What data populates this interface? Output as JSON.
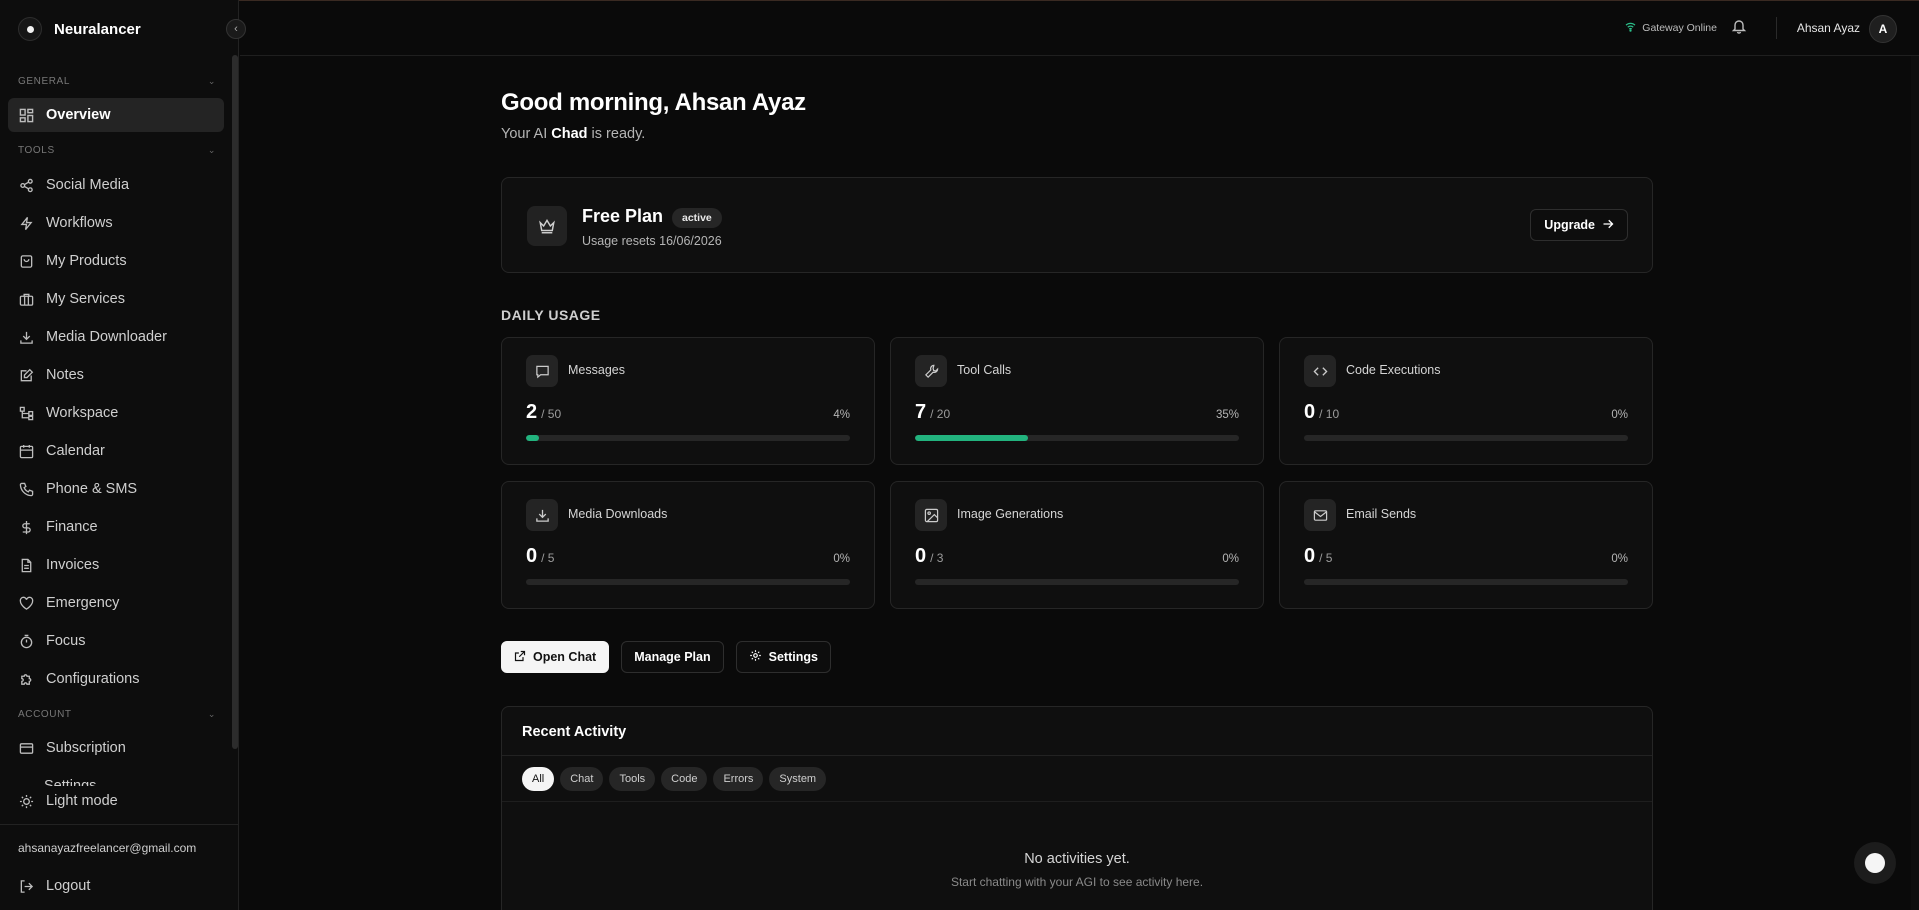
{
  "app": {
    "name": "Neuralancer"
  },
  "sidebar": {
    "sections": {
      "general": "GENERAL",
      "tools": "TOOLS",
      "account": "ACCOUNT"
    },
    "general_items": [
      {
        "label": "Overview",
        "icon": "grid-icon"
      }
    ],
    "tool_items": [
      {
        "label": "Social Media",
        "icon": "share-icon"
      },
      {
        "label": "Workflows",
        "icon": "bolt-icon"
      },
      {
        "label": "My Products",
        "icon": "shopping-bag-icon"
      },
      {
        "label": "My Services",
        "icon": "briefcase-icon"
      },
      {
        "label": "Media Downloader",
        "icon": "download-icon"
      },
      {
        "label": "Notes",
        "icon": "note-icon"
      },
      {
        "label": "Workspace",
        "icon": "workspace-icon"
      },
      {
        "label": "Calendar",
        "icon": "calendar-icon"
      },
      {
        "label": "Phone & SMS",
        "icon": "phone-icon"
      },
      {
        "label": "Finance",
        "icon": "dollar-icon"
      },
      {
        "label": "Invoices",
        "icon": "file-icon"
      },
      {
        "label": "Emergency",
        "icon": "heart-icon"
      },
      {
        "label": "Focus",
        "icon": "timer-icon"
      },
      {
        "label": "Configurations",
        "icon": "puzzle-icon"
      }
    ],
    "account_items": [
      {
        "label": "Subscription",
        "icon": "credit-card-icon"
      },
      {
        "label": "Settings",
        "icon": "gear-icon"
      }
    ],
    "light_mode": "Light mode",
    "email": "ahsanayazfreelancer@gmail.com",
    "logout": "Logout"
  },
  "topbar": {
    "gateway_status": "Gateway Online",
    "gateway_color": "#2bbf8a",
    "user_name": "Ahsan Ayaz",
    "avatar_initial": "A"
  },
  "main": {
    "greeting": "Good morning, Ahsan Ayaz",
    "sub_prefix": "Your AI",
    "agent_name": "Chad",
    "sub_suffix": "is ready.",
    "plan": {
      "title": "Free Plan",
      "badge": "active",
      "reset_text": "Usage resets 16/06/2026",
      "upgrade_label": "Upgrade"
    },
    "daily_usage_title": "DAILY USAGE",
    "usage": [
      {
        "label": "Messages",
        "icon": "message-icon",
        "used": "2",
        "limit": "/ 50",
        "percent": "4%",
        "fraction": 0.04
      },
      {
        "label": "Tool Calls",
        "icon": "wrench-icon",
        "used": "7",
        "limit": "/ 20",
        "percent": "35%",
        "fraction": 0.35
      },
      {
        "label": "Code Executions",
        "icon": "code-icon",
        "used": "0",
        "limit": "/ 10",
        "percent": "0%",
        "fraction": 0
      },
      {
        "label": "Media Downloads",
        "icon": "download-icon",
        "used": "0",
        "limit": "/ 5",
        "percent": "0%",
        "fraction": 0
      },
      {
        "label": "Image Generations",
        "icon": "image-icon",
        "used": "0",
        "limit": "/ 3",
        "percent": "0%",
        "fraction": 0
      },
      {
        "label": "Email Sends",
        "icon": "mail-icon",
        "used": "0",
        "limit": "/ 5",
        "percent": "0%",
        "fraction": 0
      }
    ],
    "actions": {
      "open_chat": "Open Chat",
      "manage_plan": "Manage Plan",
      "settings": "Settings"
    },
    "activity": {
      "title": "Recent Activity",
      "filters": [
        "All",
        "Chat",
        "Tools",
        "Code",
        "Errors",
        "System"
      ],
      "active_filter": "All",
      "empty_title": "No activities yet.",
      "empty_sub": "Start chatting with your AGI to see activity here."
    }
  },
  "colors": {
    "accent": "#22b37e",
    "background": "#0a0a0a"
  }
}
